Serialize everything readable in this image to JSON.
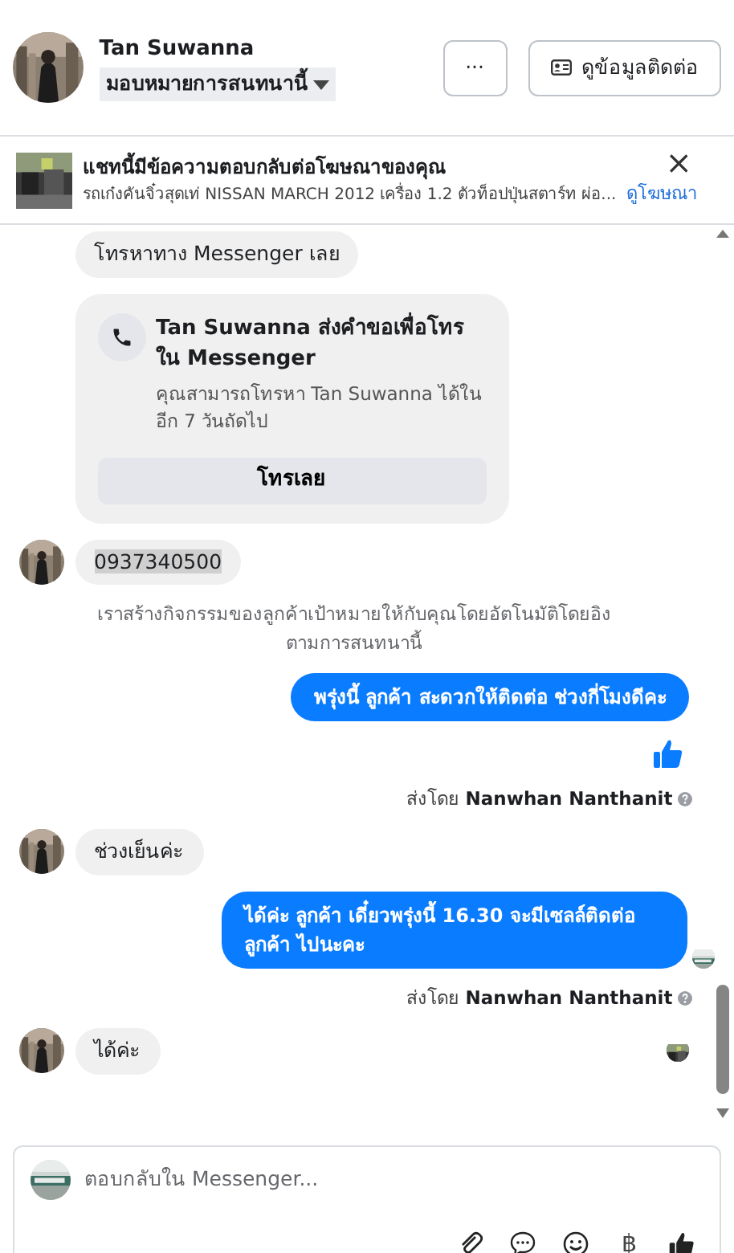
{
  "header": {
    "name": "Tan Suwanna",
    "assign_label": "มอบหมายการสนทนานี้",
    "more_button": "···",
    "contact_button": "ดูข้อมูลติดต่อ"
  },
  "ad_banner": {
    "title": "แชทนี้มีข้อความตอบกลับต่อโฆษณาของคุณ",
    "subtitle": "รถเก๋งคันจิ๋วสุดเท่ NISSAN MARCH 2012 เครื่อง 1.2 ตัวท็อปปุ่นสตาร์ท ผ่อ...",
    "link": "ดูโฆษณา",
    "close": "×"
  },
  "messages": [
    {
      "kind": "incoming",
      "text": "โทรหาทาง Messenger เลย",
      "show_avatar": false,
      "highlighted": false,
      "read_receipt": false
    },
    {
      "kind": "call_card",
      "title": "Tan Suwanna ส่งคำขอเพื่อโทรใน Messenger",
      "body": "คุณสามารถโทรหา Tan Suwanna ได้ในอีก 7 วันถัดไป",
      "button": "โทรเลย"
    },
    {
      "kind": "incoming",
      "text": "0937340500",
      "show_avatar": true,
      "highlighted": true,
      "read_receipt": false
    },
    {
      "kind": "system",
      "text": "เราสร้างกิจกรรมของลูกค้าเป้าหมายให้กับคุณโดยอัตโนมัติโดยอิงตามการสนทนานี้"
    },
    {
      "kind": "outgoing",
      "text": "พรุ่งนี้ ลูกค้า สะดวกให้ติดต่อ ช่วงกี่โมงดีคะ",
      "read_receipt": false
    },
    {
      "kind": "like"
    },
    {
      "kind": "sent_by",
      "prefix": "ส่งโดย",
      "name": "Nanwhan Nanthanit"
    },
    {
      "kind": "incoming",
      "text": "ช่วงเย็นค่ะ",
      "show_avatar": true,
      "highlighted": false,
      "read_receipt": false
    },
    {
      "kind": "outgoing",
      "text": "ได้ค่ะ  ลูกค้า เดี๋ยวพรุ่งนี้ 16.30 จะมีเซลล์ติดต่อ ลูกค้า ไปนะคะ",
      "read_receipt": true
    },
    {
      "kind": "sent_by",
      "prefix": "ส่งโดย",
      "name": "Nanwhan Nanthanit"
    },
    {
      "kind": "incoming",
      "text": "ได้ค่ะ",
      "show_avatar": true,
      "highlighted": false,
      "read_receipt": true
    }
  ],
  "composer": {
    "placeholder": "ตอบกลับใน Messenger...",
    "baht": "฿"
  }
}
